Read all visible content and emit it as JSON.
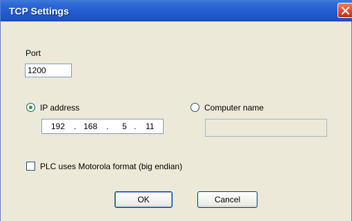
{
  "window": {
    "title": "TCP Settings"
  },
  "port": {
    "label": "Port",
    "value": "1200"
  },
  "connection": {
    "ip_label": "IP address",
    "ip_selected": true,
    "ip_octets": [
      "192",
      "168",
      "5",
      "11"
    ],
    "ip_separator": ".",
    "computer_name_label": "Computer name",
    "computer_name_selected": false,
    "computer_name_value": ""
  },
  "motorola": {
    "label": "PLC uses Motorola format (big endian)",
    "checked": false
  },
  "buttons": {
    "ok": "OK",
    "cancel": "Cancel"
  },
  "colors": {
    "titlebar": "#245ccf",
    "dialog_bg": "#ece9d8",
    "close": "#d64a27",
    "radio_dot": "#21a121"
  },
  "icons": {
    "close": "close-icon"
  }
}
